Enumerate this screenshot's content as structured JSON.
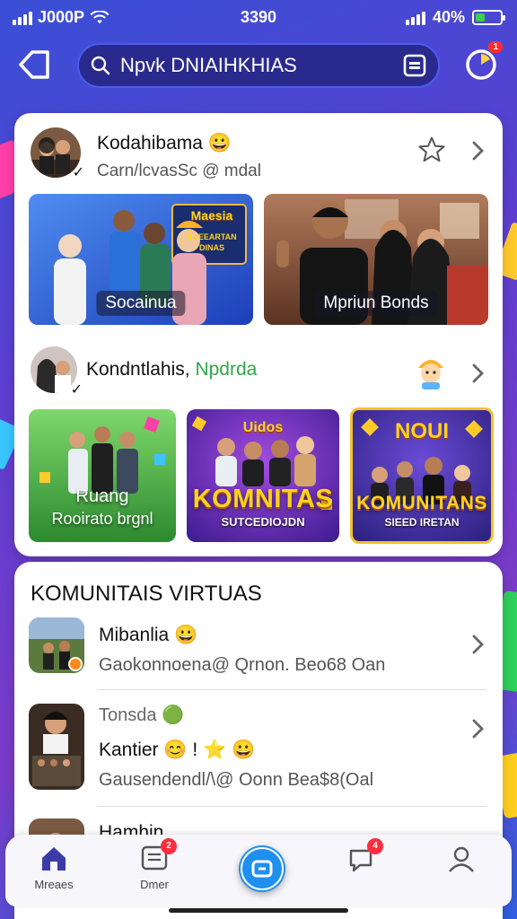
{
  "status_bar": {
    "carrier": "J000P",
    "time": "3390",
    "battery_text": "40%",
    "battery_level": 0.4
  },
  "search": {
    "text": "Npvk DNIAIHKHIAS"
  },
  "notifications": {
    "badge": "1"
  },
  "featured": {
    "group1": {
      "title": "Kodahibama",
      "subtitle": "Carn/lcvasSc @ mdal",
      "tiles": [
        {
          "label": "Socainua",
          "sign": "Maesia",
          "sign_sub": "SUEEARTAN DINAS"
        },
        {
          "label": "Mpriun Bonds"
        }
      ]
    },
    "group2": {
      "title": "Kondntlahis,",
      "title_accent": "Npdrda",
      "tiles": [
        {
          "label": "Ruang",
          "sub": "Rooirato brgnl"
        },
        {
          "top": "Uidos",
          "big": "KOMNITAS",
          "small": "SUTCEDIOJDN"
        },
        {
          "top": "NOUI",
          "big": "KOMUNITANS",
          "small": "SIEED IRETAN"
        }
      ]
    }
  },
  "communities": {
    "section_title": "KOMUNITAIS VIRTUAS",
    "items": [
      {
        "title": "Mibanlia",
        "subtitle": "Gaokonnoena@ Qrnon. Beo68 Oan"
      },
      {
        "kicker": "Tonsda",
        "title": "Kantier",
        "title_extra": "!",
        "subtitle": "Gausendendl/\\@ Oonn Bea$8(Oal"
      },
      {
        "title": "Hamhin"
      }
    ]
  },
  "bottom_nav": {
    "items": [
      {
        "label": "Mreaes"
      },
      {
        "label": "Dmer",
        "badge": "2"
      },
      {
        "label": ""
      },
      {
        "label": "",
        "badge": "4"
      },
      {
        "label": ""
      }
    ]
  },
  "colors": {
    "accent": "#1f8ff0",
    "nav_active": "#3b3ba8",
    "verified": "#2fb84a",
    "badge": "#ff2d3d"
  }
}
